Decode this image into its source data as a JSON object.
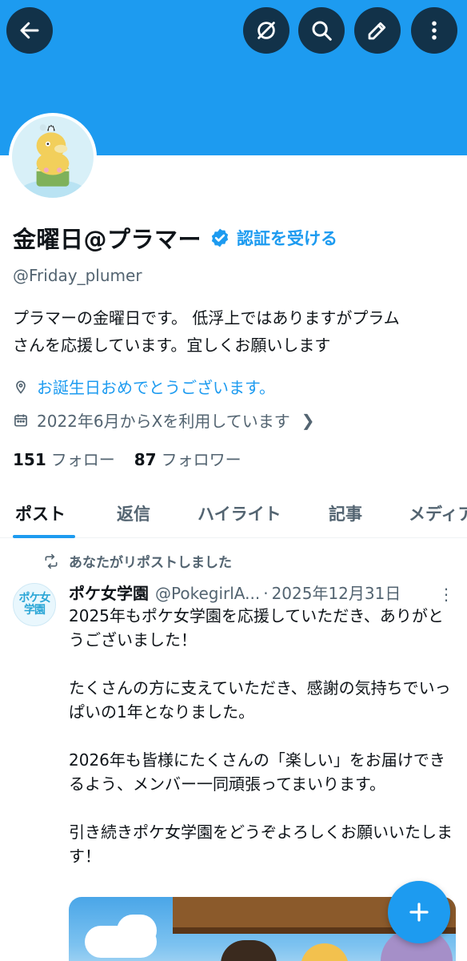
{
  "colors": {
    "accent": "#1d9bf0",
    "text": "#0f1419",
    "secondary": "#536471"
  },
  "top_bar": {
    "icons": [
      "back-arrow-icon",
      "grok-icon",
      "search-icon",
      "edit-icon",
      "more-vertical-icon"
    ]
  },
  "profile": {
    "display_name": "金曜日@プラマー",
    "verify_link": "認証を受ける",
    "handle": "@Friday_plumer",
    "bio_line1": "プラマーの金曜日です。 低浮上ではありますがプラム",
    "bio_line2": "さんを応援しています。宜しくお願いします",
    "location": "お誕生日おめでとうございます。",
    "joined": "2022年6月からXを利用しています",
    "following_count": "151",
    "following_label": "フォロー",
    "followers_count": "87",
    "followers_label": "フォロワー"
  },
  "tabs": [
    {
      "label": "ポスト",
      "active": true
    },
    {
      "label": "返信",
      "active": false
    },
    {
      "label": "ハイライト",
      "active": false
    },
    {
      "label": "記事",
      "active": false
    },
    {
      "label": "メディア",
      "active": false
    }
  ],
  "timeline": {
    "repost_label": "あなたがリポストしました",
    "post": {
      "avatar_text_line1": "ポケ女",
      "avatar_text_line2": "学園",
      "author": "ポケ女学園",
      "handle": "@PokegirlA...",
      "separator": "·",
      "date": "2025年12月31日",
      "menu": "⋮",
      "paragraph1": "2025年もポケ女学園を応援していただき、ありがとうございました！",
      "paragraph2": "たくさんの方に支えていただき、感謝の気持ちでいっぱいの1年となりました。",
      "paragraph3": "2026年も皆様にたくさんの「楽しい」をお届けできるよう、メンバー一同頑張ってまいります。",
      "paragraph4": "引き続きポケ女学園をどうぞよろしくお願いいたします！"
    }
  },
  "fab_icon": "plus-icon"
}
